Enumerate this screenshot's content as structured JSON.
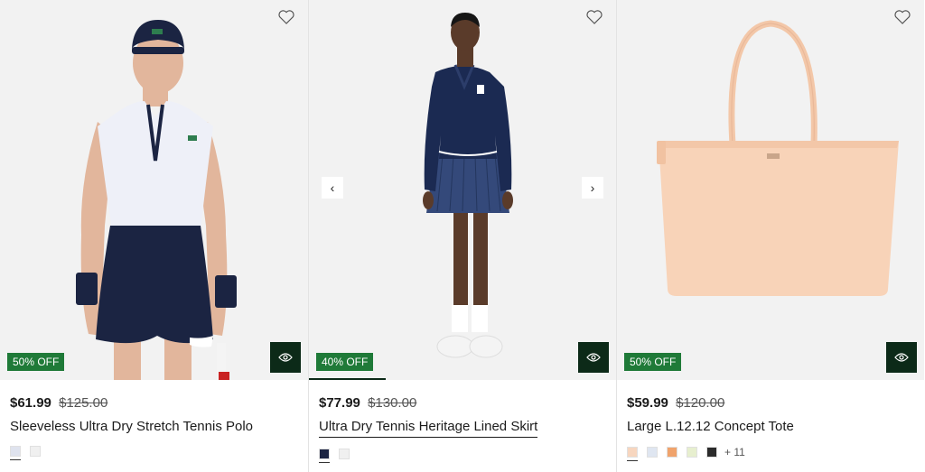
{
  "products": [
    {
      "price": "$61.99",
      "original_price": "$125.00",
      "name": "Sleeveless Ultra Dry Stretch Tennis Polo",
      "badge": "50% OFF",
      "swatches": [
        "#dfe3ee",
        "#f0f0f0"
      ],
      "more": ""
    },
    {
      "price": "$77.99",
      "original_price": "$130.00",
      "name": "Ultra Dry Tennis Heritage Lined Skirt",
      "badge": "40% OFF",
      "swatches": [
        "#1b2442",
        "#f0f0f0"
      ],
      "more": ""
    },
    {
      "price": "$59.99",
      "original_price": "$120.00",
      "name": "Large L.12.12 Concept Tote",
      "badge": "50% OFF",
      "swatches": [
        "#f7d6bf",
        "#dfe6f1",
        "#f0a36c",
        "#e7efcf",
        "#2b2b2b"
      ],
      "more": "+ 11"
    }
  ],
  "carousel": {
    "prev": "‹",
    "next": "›"
  },
  "colors": {
    "badge": "#1f7a38",
    "quick_view": "#0c2a18",
    "image_bg": "#f2f2f2"
  },
  "icons": {
    "wishlist": "heart-outline-icon",
    "quick_view": "eye-icon"
  }
}
